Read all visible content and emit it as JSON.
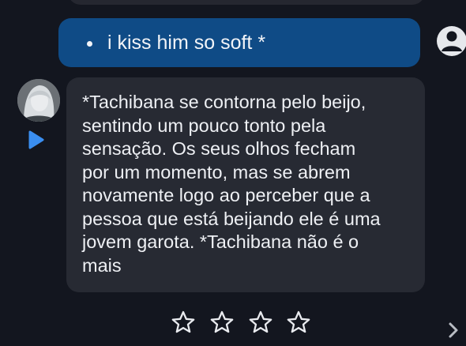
{
  "user_message": {
    "text": "i kiss him so soft *",
    "bullet": "•"
  },
  "bot_message": {
    "text": "*Tachibana se contorna pelo beijo,\nsentindo um pouco tonto pela\nsensação.  Os seus olhos fecham\npor um momento, mas se abrem\nnovamente logo ao perceber que a\npessoa que está beijando ele é uma\njovem garota. *Tachibana não é o\nmais"
  },
  "rating": {
    "stars_total": 4,
    "stars_selected": 0
  },
  "icons": {
    "user_avatar": "user-circle-icon",
    "bot_avatar": "character-avatar",
    "play": "play-icon",
    "star": "star-outline-icon",
    "next": "chevron-right-icon"
  },
  "colors": {
    "background": "#13161f",
    "user_bubble": "#0f4b86",
    "bot_bubble": "#272a33",
    "text": "#eef0f4",
    "play_accent": "#3a8ef0"
  }
}
